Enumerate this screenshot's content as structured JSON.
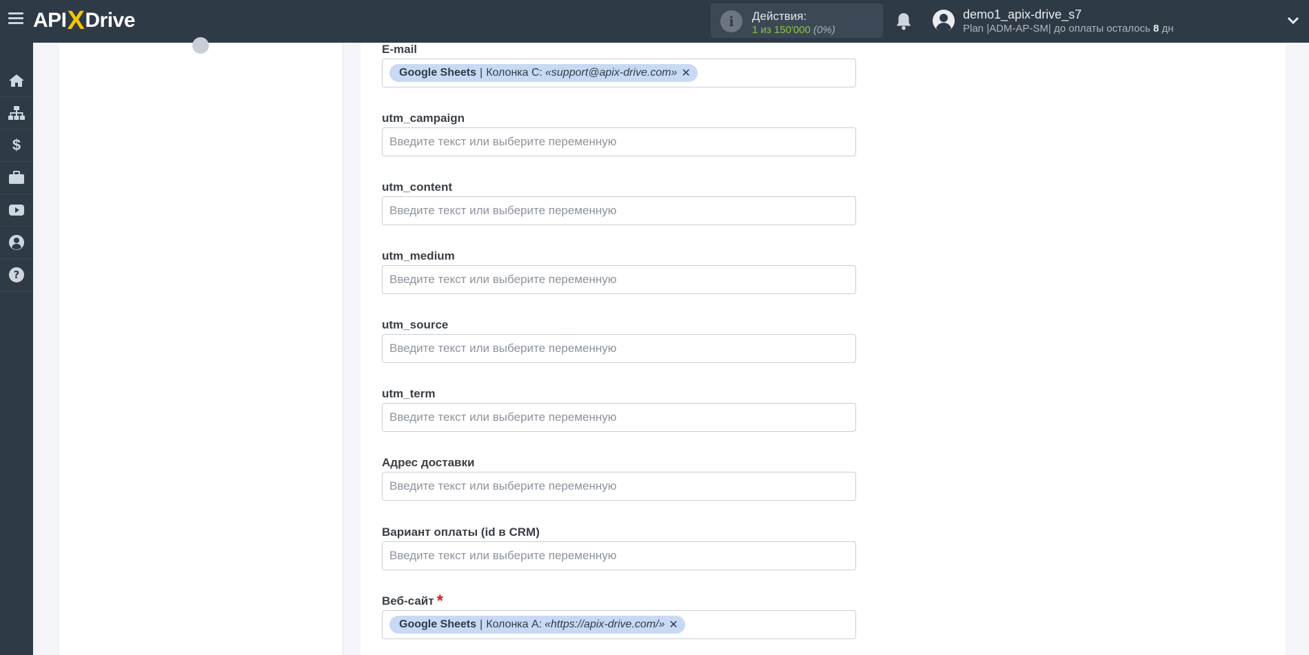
{
  "header": {
    "logo": {
      "api": "API",
      "x": "X",
      "drive": "Drive"
    },
    "actions": {
      "title": "Действия:",
      "count": "1 из 150'000",
      "percent": "(0%)"
    },
    "user": {
      "name": "demo1_apix-drive_s7",
      "plan_prefix": "Plan |ADM-AP-SM| до оплаты осталось ",
      "days": "8",
      "days_suffix": " дн"
    }
  },
  "sidebar": {
    "items": [
      {
        "icon": "home-icon"
      },
      {
        "icon": "sitemap-icon"
      },
      {
        "icon": "dollar-icon"
      },
      {
        "icon": "briefcase-icon"
      },
      {
        "icon": "youtube-icon"
      },
      {
        "icon": "user-circle-icon"
      },
      {
        "icon": "question-circle-icon"
      }
    ]
  },
  "placeholder": "Введите текст или выберите переменную",
  "fields": [
    {
      "label": "E-mail",
      "chip": {
        "source": "Google Sheets",
        "column": "Колонка C:",
        "value": "«support@apix-drive.com»"
      }
    },
    {
      "label": "utm_campaign"
    },
    {
      "label": "utm_content"
    },
    {
      "label": "utm_medium"
    },
    {
      "label": "utm_source"
    },
    {
      "label": "utm_term"
    },
    {
      "label": "Адрес доставки"
    },
    {
      "label": "Вариант оплаты (id в CRM)"
    },
    {
      "label": "Веб-сайт",
      "required": "*",
      "chip": {
        "source": "Google Sheets",
        "column": "Колонка А:",
        "value": "«https://apix-drive.com/»"
      }
    }
  ],
  "colors": {
    "topbar": "#2f3a47",
    "chip": "#c8daf3",
    "accent_green": "#8ec63f",
    "required": "#d61b1b"
  }
}
